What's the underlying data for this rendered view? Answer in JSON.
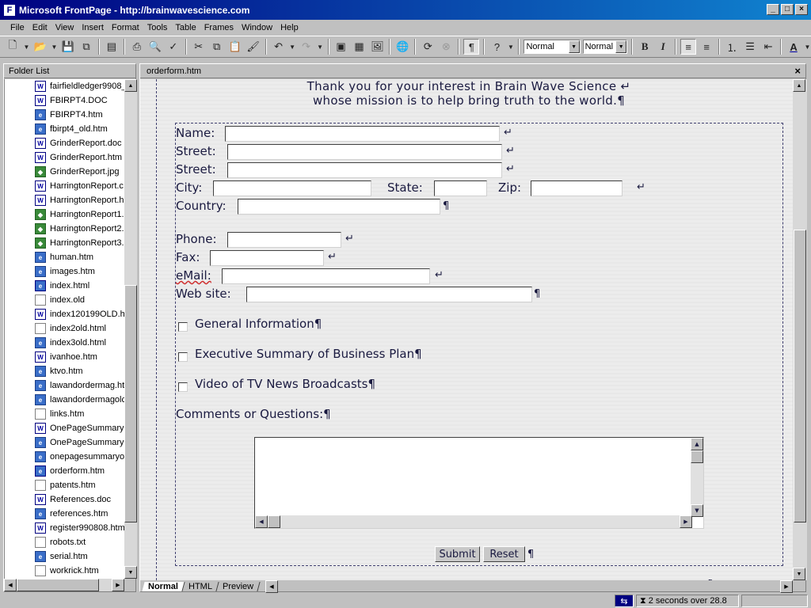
{
  "window": {
    "title": "Microsoft FrontPage - http://brainwavescience.com"
  },
  "menu": [
    "File",
    "Edit",
    "View",
    "Insert",
    "Format",
    "Tools",
    "Table",
    "Frames",
    "Window",
    "Help"
  ],
  "toolbar": {
    "style_value": "Normal",
    "font_value": "Normal"
  },
  "folder_list": {
    "title": "Folder List",
    "items": [
      {
        "name": "fairfieldledger9908_",
        "type": "doc"
      },
      {
        "name": "FBIRPT4.DOC",
        "type": "doc"
      },
      {
        "name": "FBIRPT4.htm",
        "type": "web"
      },
      {
        "name": "fbirpt4_old.htm",
        "type": "web"
      },
      {
        "name": "GrinderReport.doc",
        "type": "doc"
      },
      {
        "name": "GrinderReport.htm",
        "type": "doc"
      },
      {
        "name": "GrinderReport.jpg",
        "type": "img"
      },
      {
        "name": "HarringtonReport.c",
        "type": "doc"
      },
      {
        "name": "HarringtonReport.h",
        "type": "doc"
      },
      {
        "name": "HarringtonReport1.",
        "type": "img"
      },
      {
        "name": "HarringtonReport2.",
        "type": "img"
      },
      {
        "name": "HarringtonReport3.",
        "type": "img"
      },
      {
        "name": "human.htm",
        "type": "web"
      },
      {
        "name": "images.htm",
        "type": "web"
      },
      {
        "name": "index.html",
        "type": "home"
      },
      {
        "name": "index.old",
        "type": "txt"
      },
      {
        "name": "index120199OLD.h",
        "type": "doc"
      },
      {
        "name": "index2old.html",
        "type": "txt"
      },
      {
        "name": "index3old.html",
        "type": "web"
      },
      {
        "name": "ivanhoe.htm",
        "type": "doc"
      },
      {
        "name": "ktvo.htm",
        "type": "web"
      },
      {
        "name": "lawandordermag.ht",
        "type": "web"
      },
      {
        "name": "lawandordermagolc",
        "type": "web"
      },
      {
        "name": "links.htm",
        "type": "txt"
      },
      {
        "name": "OnePageSummary",
        "type": "doc"
      },
      {
        "name": "OnePageSummary",
        "type": "web"
      },
      {
        "name": "onepagesummaryo",
        "type": "web"
      },
      {
        "name": "orderform.htm",
        "type": "home"
      },
      {
        "name": "patents.htm",
        "type": "txt"
      },
      {
        "name": "References.doc",
        "type": "doc"
      },
      {
        "name": "references.htm",
        "type": "web"
      },
      {
        "name": "register990808.htm",
        "type": "doc"
      },
      {
        "name": "robots.txt",
        "type": "txt"
      },
      {
        "name": "serial.htm",
        "type": "web"
      },
      {
        "name": "workrick.htm",
        "type": "txt"
      }
    ]
  },
  "editor": {
    "tab_title": "orderform.htm",
    "intro_line1": "Thank you for your interest in Brain Wave Science",
    "intro_line2": "whose mission is to help bring truth to the world.",
    "labels": {
      "name": "Name:",
      "street1": "Street:",
      "street2": "Street:",
      "city": "City:",
      "state": "State:",
      "zip": "Zip:",
      "country": "Country:",
      "phone": "Phone:",
      "fax": "Fax:",
      "email": "eMail:",
      "website": "Web site:",
      "comments": "Comments or Questions:"
    },
    "checkboxes": [
      "General Information",
      "Executive Summary of Business Plan",
      "Video of TV News Broadcasts"
    ],
    "buttons": {
      "submit": "Submit",
      "reset": "Reset"
    },
    "marks": {
      "pilcrow": "¶",
      "line_break": "↵"
    }
  },
  "view_tabs": [
    "Normal",
    "HTML",
    "Preview"
  ],
  "status": {
    "time": "2 seconds over 28.8"
  }
}
